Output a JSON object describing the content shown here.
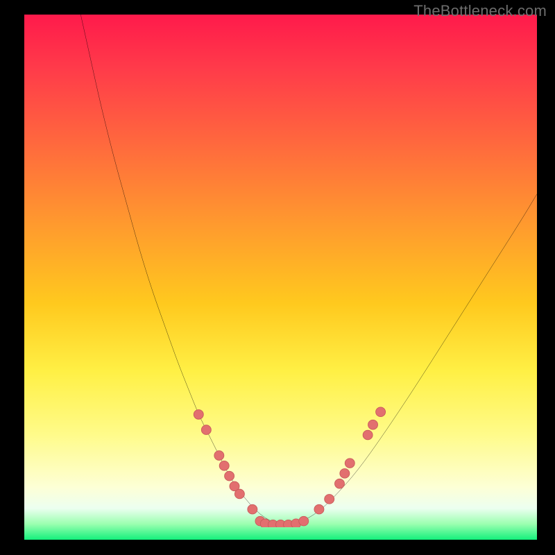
{
  "watermark": {
    "text": "TheBottleneck.com"
  },
  "colors": {
    "background": "#000000",
    "curve": "#000000",
    "dot_fill": "#e26f6f",
    "dot_stroke": "#c85a5a"
  },
  "chart_data": {
    "type": "line",
    "title": "",
    "xlabel": "",
    "ylabel": "",
    "xlim": [
      0,
      100
    ],
    "ylim": [
      0,
      100
    ],
    "grid": false,
    "legend": false,
    "series": [
      {
        "name": "curve",
        "x": [
          11.0,
          13.0,
          15.0,
          17.5,
          20.0,
          22.5,
          25.0,
          27.5,
          30.0,
          32.0,
          34.0,
          36.0,
          38.0,
          40.0,
          42.0,
          44.0,
          46.0,
          48.0,
          50.0,
          52.0,
          55.0,
          58.0,
          61.0,
          65.0,
          70.0,
          76.0,
          83.0,
          90.0,
          97.0,
          100.0
        ],
        "y": [
          100,
          91,
          82,
          72,
          63,
          54,
          46,
          39,
          32,
          27,
          22,
          18,
          14,
          10,
          7,
          4.5,
          2.5,
          1.2,
          0.5,
          0.5,
          1.5,
          3.5,
          6.5,
          11,
          18,
          27,
          38,
          49,
          60,
          65
        ]
      }
    ],
    "plateau": {
      "x_start": 46,
      "x_end": 53,
      "y": 0.5
    },
    "dots": [
      {
        "x": 34.0,
        "y": 22.0
      },
      {
        "x": 35.5,
        "y": 19.0
      },
      {
        "x": 38.0,
        "y": 14.0
      },
      {
        "x": 39.0,
        "y": 12.0
      },
      {
        "x": 40.0,
        "y": 10.0
      },
      {
        "x": 41.0,
        "y": 8.0
      },
      {
        "x": 42.0,
        "y": 6.5
      },
      {
        "x": 44.5,
        "y": 3.5
      },
      {
        "x": 46.0,
        "y": 1.2
      },
      {
        "x": 47.0,
        "y": 0.7
      },
      {
        "x": 48.5,
        "y": 0.5
      },
      {
        "x": 50.0,
        "y": 0.5
      },
      {
        "x": 51.5,
        "y": 0.5
      },
      {
        "x": 53.0,
        "y": 0.7
      },
      {
        "x": 54.5,
        "y": 1.2
      },
      {
        "x": 57.5,
        "y": 3.5
      },
      {
        "x": 59.5,
        "y": 5.5
      },
      {
        "x": 61.5,
        "y": 8.5
      },
      {
        "x": 62.5,
        "y": 10.5
      },
      {
        "x": 63.5,
        "y": 12.5
      },
      {
        "x": 67.0,
        "y": 18.0
      },
      {
        "x": 68.0,
        "y": 20.0
      },
      {
        "x": 69.5,
        "y": 22.5
      }
    ]
  }
}
